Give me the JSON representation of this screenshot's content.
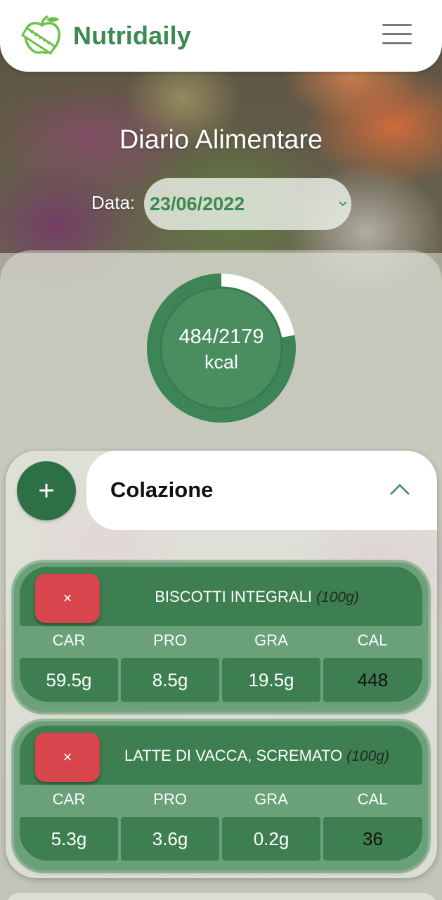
{
  "header": {
    "brand": "Nutridaily",
    "logo_icon": "apple-measuring-tape-icon",
    "menu_icon": "hamburger-menu-icon"
  },
  "page": {
    "title": "Diario Alimentare",
    "date_label": "Data:",
    "date_value": "23/06/2022"
  },
  "calories": {
    "text": "484/2179",
    "unit": "kcal",
    "consumed": 484,
    "goal": 2179
  },
  "meal": {
    "title": "Colazione",
    "add_icon": "+",
    "items": [
      {
        "remove_icon": "×",
        "name": "BISCOTTI INTEGRALI",
        "portion": "(100g)",
        "labels": [
          "CAR",
          "PRO",
          "GRA",
          "CAL"
        ],
        "values": [
          "59.5g",
          "8.5g",
          "19.5g",
          "448"
        ]
      },
      {
        "remove_icon": "×",
        "name": "LATTE DI VACCA, SCREMATO",
        "portion": "(100g)",
        "labels": [
          "CAR",
          "PRO",
          "GRA",
          "CAL"
        ],
        "values": [
          "5.3g",
          "3.6g",
          "0.2g",
          "36"
        ]
      }
    ]
  },
  "colors": {
    "brand_green": "#3a8a52",
    "dark_green": "#2e7046",
    "card_green": "#6aa17a",
    "remove_red": "#d8454d"
  }
}
